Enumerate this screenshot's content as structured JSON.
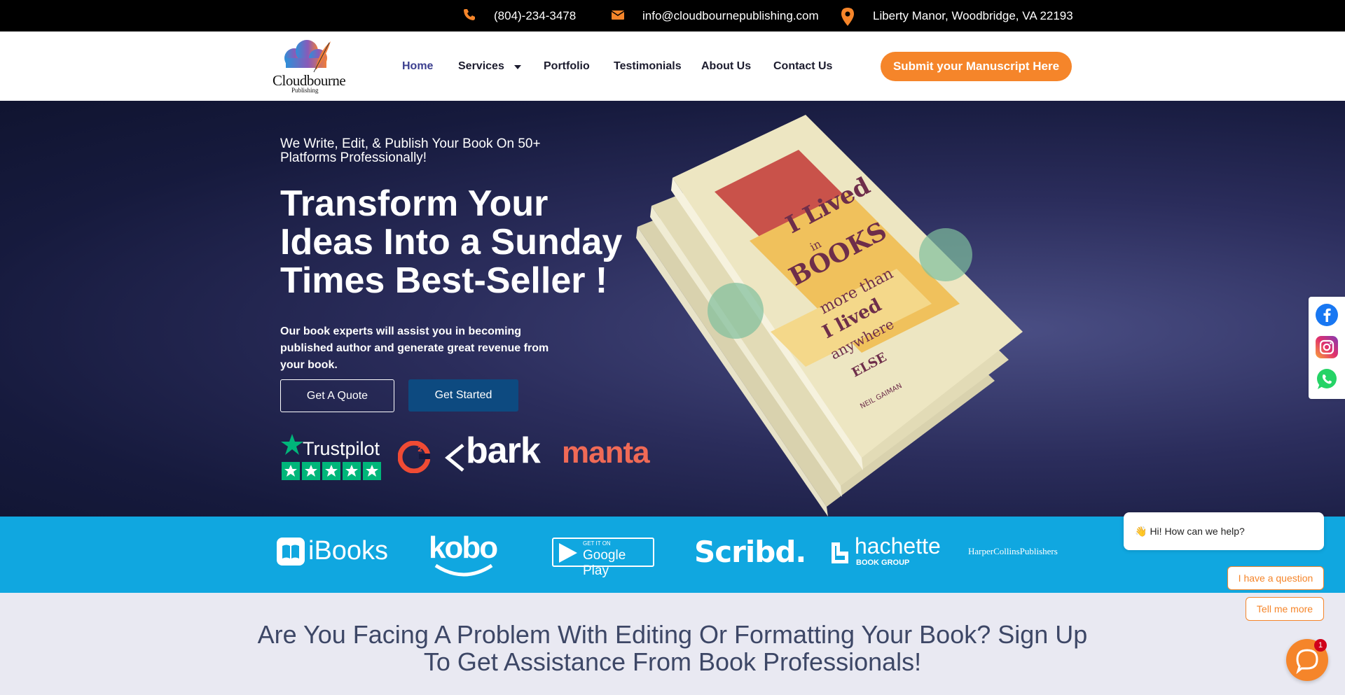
{
  "topbar": {
    "phone": "(804)-234-3478",
    "email": "info@cloudbournepublishing.com",
    "address": "Liberty Manor, Woodbridge, VA 22193",
    "icon_color": "#f5852a"
  },
  "header": {
    "logo_text": "Cloudbourne",
    "logo_sub": "Publishing",
    "nav": [
      {
        "label": "Home",
        "active": true
      },
      {
        "label": "Services",
        "has_dropdown": true
      },
      {
        "label": "Portfolio"
      },
      {
        "label": "Testimonials"
      },
      {
        "label": "About Us"
      },
      {
        "label": "Contact Us"
      }
    ],
    "cta": "Submit your Manuscript Here",
    "accent": "#f5852a"
  },
  "hero": {
    "subtitle": "We Write, Edit, & Publish Your Book On 50+ Platforms Professionally!",
    "title": "Transform Your Ideas Into a Sunday Times Best-Seller !",
    "description": "Our book experts will assist you in becoming published author and generate great revenue from your book.",
    "btn_quote": "Get A Quote",
    "btn_start": "Get Started",
    "reviews": [
      "Trustpilot",
      "G2",
      "bark",
      "manta"
    ],
    "book_cover_text": [
      "I Lived",
      "in",
      "BOOKS",
      "more than",
      "I lived",
      "anywhere",
      "ELSE",
      "NEIL GAIMAN"
    ]
  },
  "platforms": [
    "iBooks",
    "kobo",
    "Google Play",
    "Scribd.",
    "hachette",
    "HarperCollinsPublishers"
  ],
  "platform_extras": {
    "google_small": "GET IT ON",
    "hachette_sub": "BOOK GROUP"
  },
  "problem": {
    "title": "Are You Facing A Problem With Editing Or Formatting Your Book? Sign Up To Get Assistance From Book Professionals!"
  },
  "social": [
    "facebook-icon",
    "instagram-icon",
    "whatsapp-icon"
  ],
  "chat": {
    "greeting": "Hi! How can we help?",
    "greeting_emoji": "👋",
    "option1": "I have a question",
    "option2": "Tell me more",
    "badge": "1"
  }
}
